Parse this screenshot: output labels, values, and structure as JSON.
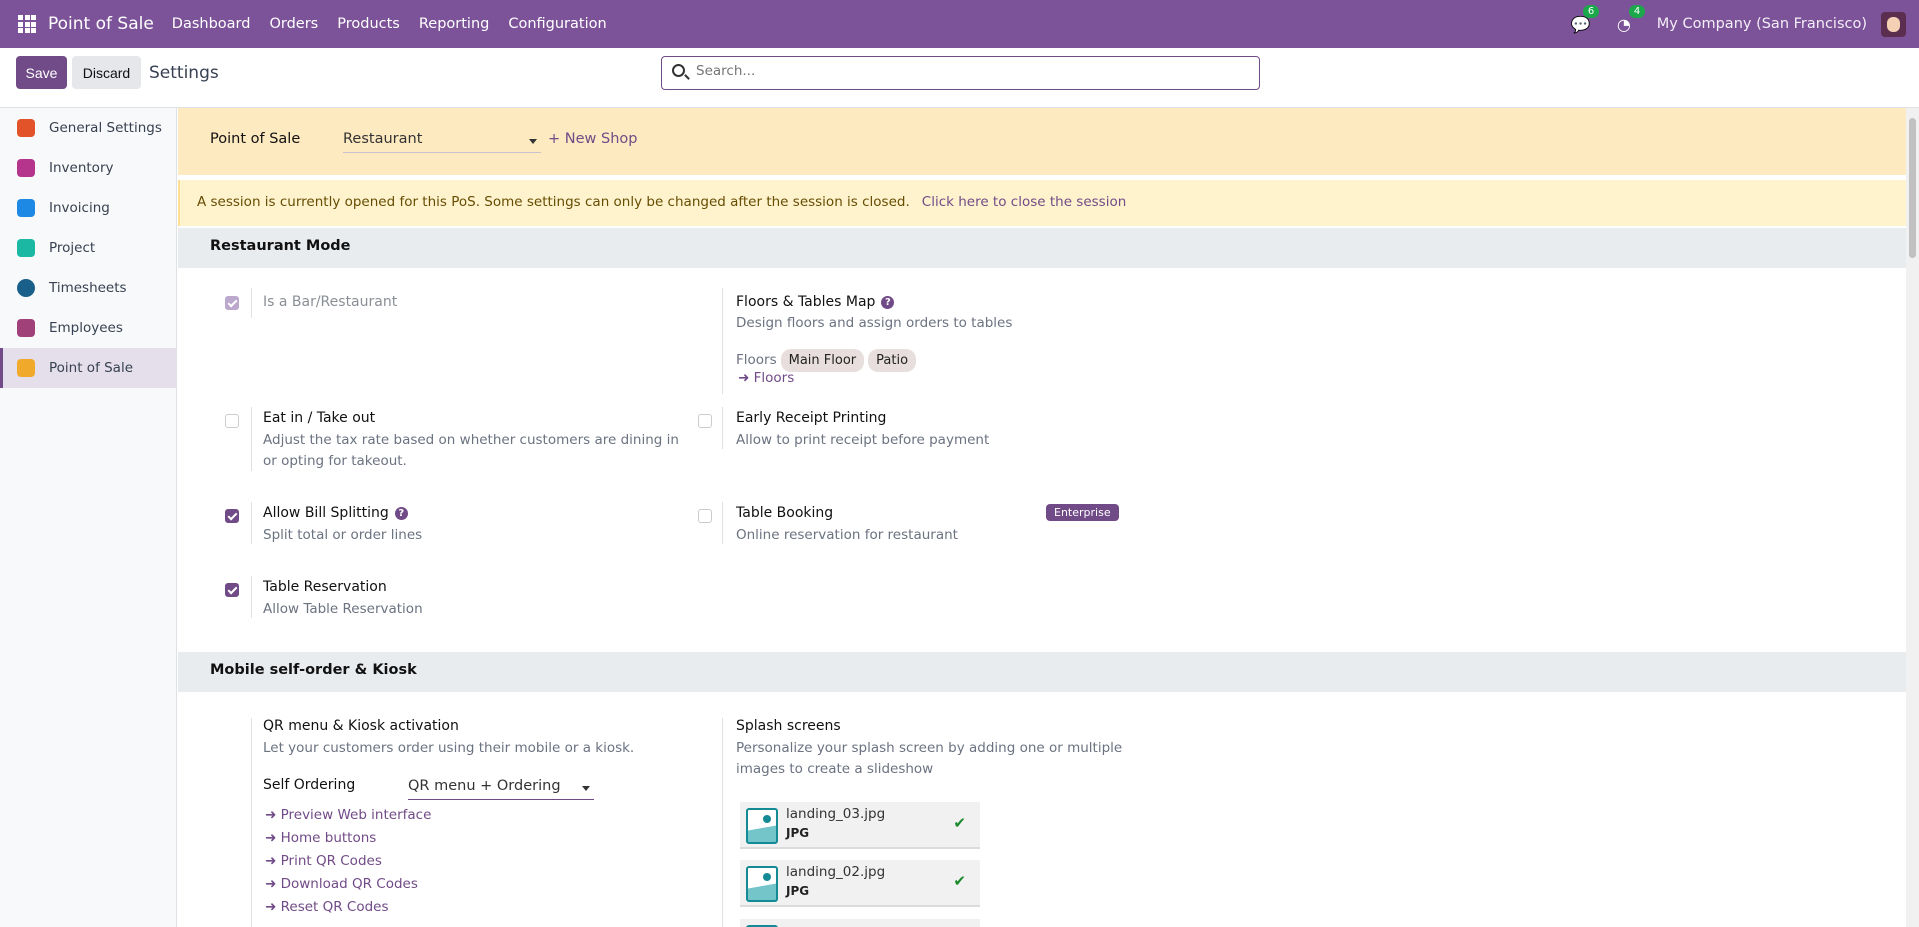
{
  "navbar": {
    "app_name": "Point of Sale",
    "menu": [
      "Dashboard",
      "Orders",
      "Products",
      "Reporting",
      "Configuration"
    ],
    "messages_count": "6",
    "activities_count": "4",
    "company": "My Company (San Francisco)"
  },
  "control_panel": {
    "save": "Save",
    "discard": "Discard",
    "title": "Settings",
    "search_placeholder": "Search..."
  },
  "sidebar": {
    "items": [
      {
        "label": "General Settings",
        "color": "#e2532a"
      },
      {
        "label": "Inventory",
        "color": "#b5358c"
      },
      {
        "label": "Invoicing",
        "color": "#1e88e5"
      },
      {
        "label": "Project",
        "color": "#1bb9a4"
      },
      {
        "label": "Timesheets",
        "color": "#1a5e8a"
      },
      {
        "label": "Employees",
        "color": "#a0417a"
      },
      {
        "label": "Point of Sale",
        "color": "#f0a92a"
      }
    ]
  },
  "pos_banner": {
    "label": "Point of Sale",
    "selected_shop": "Restaurant",
    "new_shop": "+ New Shop"
  },
  "alert": {
    "text": "A session is currently opened for this PoS. Some settings can only be changed after the session is closed.",
    "link": "Click here to close the session"
  },
  "restaurant_mode": {
    "header": "Restaurant Mode",
    "is_bar": {
      "label": "Is a Bar/Restaurant",
      "checked": true
    },
    "floors_map": {
      "title": "Floors & Tables Map",
      "desc": "Design floors and assign orders to tables",
      "floors_label": "Floors",
      "floors": [
        "Main Floor",
        "Patio"
      ],
      "link": "Floors"
    },
    "eat_in": {
      "title": "Eat in / Take out",
      "desc": "Adjust the tax rate based on whether customers are dining in or opting for takeout.",
      "checked": false
    },
    "early_receipt": {
      "title": "Early Receipt Printing",
      "desc": "Allow to print receipt before payment",
      "checked": false
    },
    "bill_split": {
      "title": "Allow Bill Splitting",
      "desc": "Split total or order lines",
      "checked": true
    },
    "table_booking": {
      "title": "Table Booking",
      "desc": "Online reservation for restaurant",
      "badge": "Enterprise",
      "checked": false
    },
    "table_reservation": {
      "title": "Table Reservation",
      "desc": "Allow Table Reservation",
      "checked": true
    }
  },
  "mobile": {
    "header": "Mobile self-order & Kiosk",
    "qr": {
      "title": "QR menu & Kiosk activation",
      "desc": "Let your customers order using their mobile or a kiosk.",
      "self_ordering_label": "Self Ordering",
      "self_ordering_value": "QR menu + Ordering",
      "links": [
        "Preview Web interface",
        "Home buttons",
        "Print QR Codes",
        "Download QR Codes",
        "Reset QR Codes"
      ]
    },
    "splash": {
      "title": "Splash screens",
      "desc": "Personalize your splash screen by adding one or multiple images to create a slideshow",
      "files": [
        {
          "name": "landing_03.jpg",
          "type": "JPG"
        },
        {
          "name": "landing_02.jpg",
          "type": "JPG"
        }
      ]
    }
  }
}
